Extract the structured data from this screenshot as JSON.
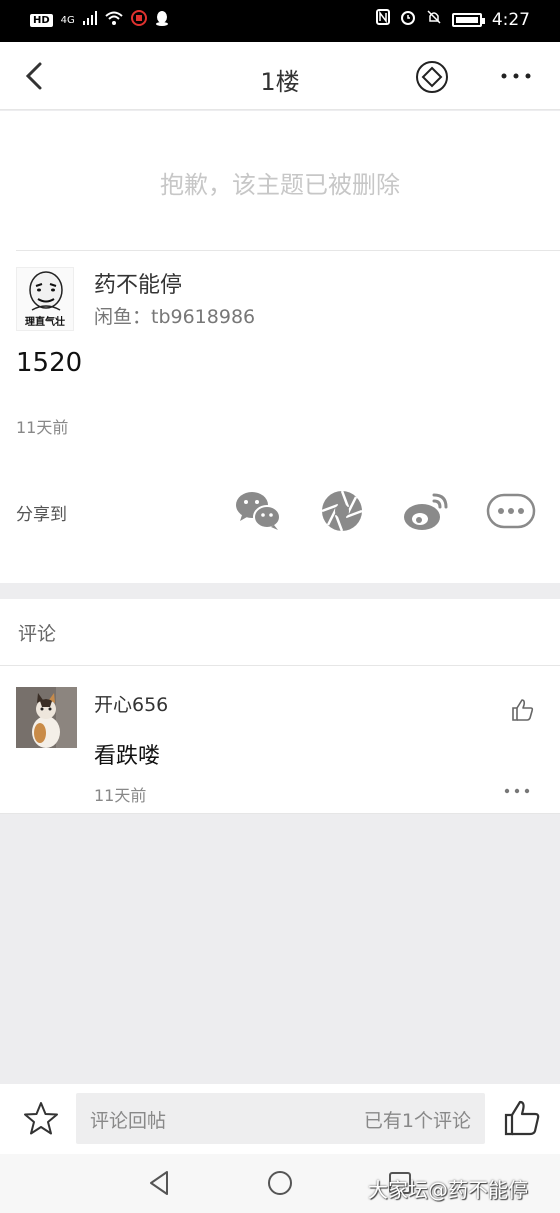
{
  "status_bar": {
    "network": "4G",
    "hd": "HD",
    "time": "4:27"
  },
  "nav": {
    "title": "1楼"
  },
  "post": {
    "deleted_notice": "抱歉，该主题已被删除",
    "avatar_caption": "理直气壮",
    "author": "药不能停",
    "subtitle": "闲鱼：tb9618986",
    "content": "1520",
    "time": "11天前",
    "share_label": "分享到",
    "share_targets": [
      "wechat-icon",
      "moments-icon",
      "weibo-icon",
      "more-share-icon"
    ]
  },
  "comments": {
    "header": "评论",
    "items": [
      {
        "author": "开心656",
        "text": "看跌喽",
        "time": "11天前"
      }
    ]
  },
  "composer": {
    "placeholder": "评论回帖",
    "count": "已有1个评论"
  },
  "watermark": "大家坛@药不能停",
  "colors": {
    "accent_gray": "#888888",
    "background": "#ededef",
    "weibo_gray": "#8a8a8a"
  }
}
